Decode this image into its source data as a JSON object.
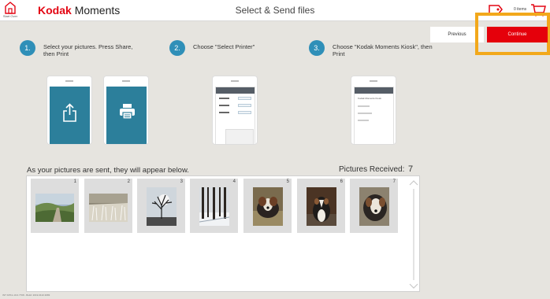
{
  "header": {
    "start_over_label": "Start Over",
    "brand_kodak": "Kodak",
    "brand_moments": "Moments",
    "title": "Select & Send files",
    "cart_count": "0 items"
  },
  "nav": {
    "previous_label": "Previous",
    "continue_label": "Continue"
  },
  "steps": [
    {
      "number": "1.",
      "text": "Select your pictures. Press Share, then Print"
    },
    {
      "number": "2.",
      "text": "Choose \"Select Printer\""
    },
    {
      "number": "3.",
      "text": "Choose \"Kodak Moments Kiosk\", then Print"
    }
  ],
  "phone_kiosk_label": "Kodak Moments Kiosk",
  "received": {
    "caption": "As your pictures are sent, they will appear below.",
    "count_label": "Pictures Received:",
    "count": "7"
  },
  "pictures": [
    {
      "number": "1",
      "subject": "landscape-hills"
    },
    {
      "number": "2",
      "subject": "dry-grass-field"
    },
    {
      "number": "3",
      "subject": "bare-tree-sky"
    },
    {
      "number": "4",
      "subject": "snowy-forest"
    },
    {
      "number": "5",
      "subject": "dog-in-grass"
    },
    {
      "number": "6",
      "subject": "dog-sitting"
    },
    {
      "number": "7",
      "subject": "dog-close-up"
    }
  ],
  "build_info": "INT  KPK1-19.0.7708 - Build: 2019.0410.3083",
  "colors": {
    "accent_blue": "#2f8fb8",
    "continue_red": "#e5000b",
    "highlight_orange": "#f2a81b",
    "brand_red": "#e30613"
  },
  "icons": {
    "start_over": "home-icon",
    "share": "share-icon",
    "print": "printer-icon",
    "cart": "cart-icon",
    "tag": "price-tag-icon"
  }
}
